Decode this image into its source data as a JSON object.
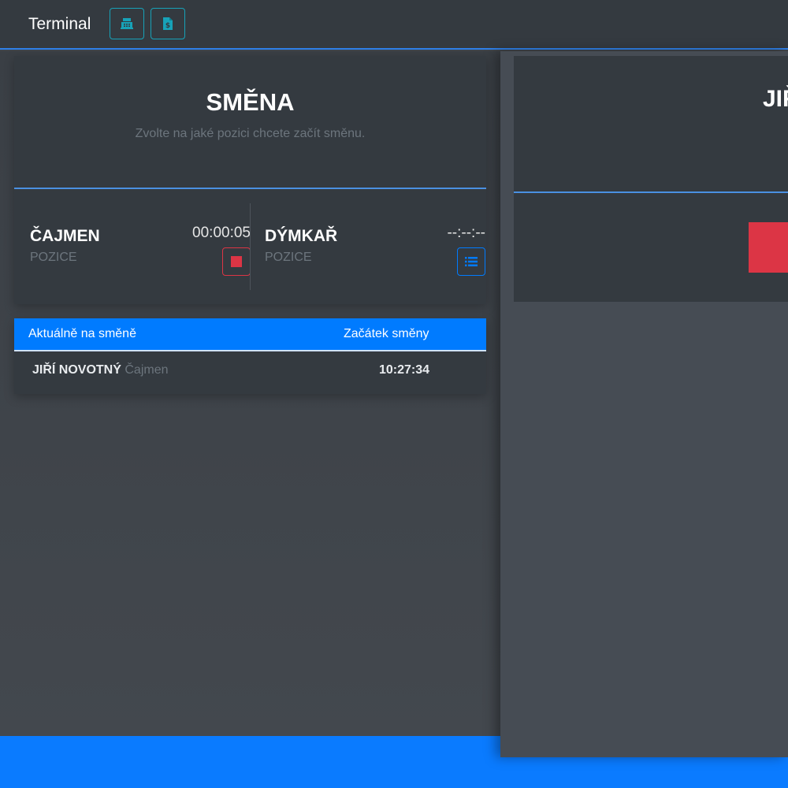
{
  "header": {
    "brand": "Terminal",
    "icons": [
      "cash-register-icon",
      "invoice-icon"
    ]
  },
  "shift_card": {
    "title": "SMĚNA",
    "subtitle": "Zvolte na jaké pozici chcete začít směnu.",
    "positions": [
      {
        "name": "ČAJMEN",
        "label": "POZICE",
        "time": "00:00:05",
        "action_icon": "stop-icon",
        "status_color": "#dc3545"
      },
      {
        "name": "DÝMKAŘ",
        "label": "POZICE",
        "time": "--:--:--",
        "action_icon": "list-icon",
        "status_color": "#007bff"
      }
    ]
  },
  "shift_table": {
    "columns": [
      "Aktuálně na směně",
      "Začátek směny"
    ],
    "rows": [
      {
        "name": "JIŘÍ NOVOTNÝ",
        "position": "Čajmen",
        "start": "10:27:34"
      }
    ]
  },
  "right_panel": {
    "title": "JIŘ"
  },
  "colors": {
    "accent": "#007bff",
    "danger": "#dc3545",
    "info": "#17a2b8",
    "card": "#343a40"
  }
}
